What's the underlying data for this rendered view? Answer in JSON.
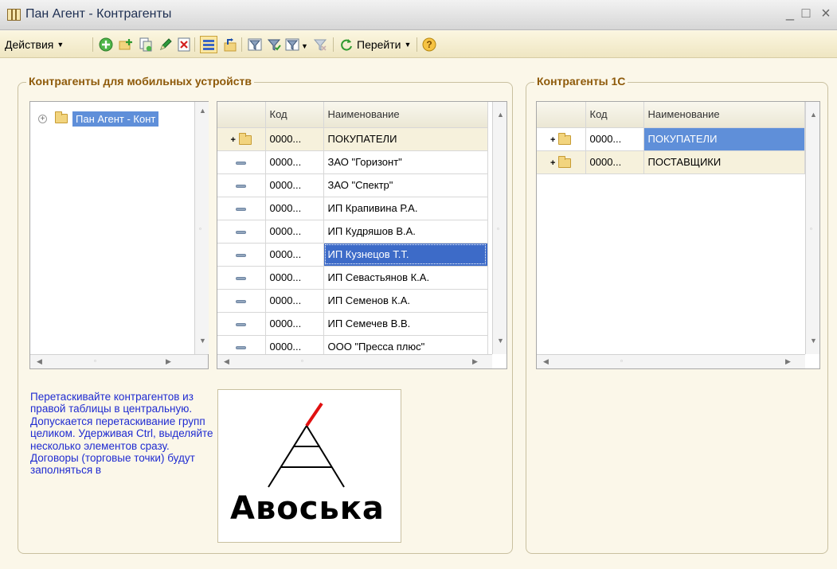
{
  "window": {
    "title": "Пан Агент - Контрагенты",
    "minimize": "_",
    "maximize": "□",
    "close": "×"
  },
  "toolbar": {
    "actions_label": "Действия",
    "goto_label": "Перейти",
    "icons": [
      "add-icon",
      "add-group-icon",
      "copy-icon",
      "edit-icon",
      "delete-icon",
      "list-view-icon",
      "refresh-level-icon",
      "filter-icon",
      "filter-value-icon",
      "filter-list-icon",
      "clear-filter-icon",
      "refresh-icon",
      "help-icon"
    ]
  },
  "left_group": {
    "title": "Контрагенты для мобильных устройств",
    "tree": {
      "label": "Пан Агент - Конт",
      "expander": "⊕"
    },
    "center_table": {
      "col_code": "Код",
      "col_name": "Наименование",
      "rows": [
        {
          "type": "group",
          "code": "0000...",
          "name": "ПОКУПАТЕЛИ",
          "marker": "+"
        },
        {
          "type": "item",
          "code": "0000...",
          "name": "ЗАО \"Горизонт\""
        },
        {
          "type": "item",
          "code": "0000...",
          "name": "ЗАО \"Спектр\""
        },
        {
          "type": "item",
          "code": "0000...",
          "name": "ИП Крапивина Р.А."
        },
        {
          "type": "item",
          "code": "0000...",
          "name": "ИП Кудряшов В.А."
        },
        {
          "type": "item",
          "code": "0000...",
          "name": "ИП Кузнецов Т.Т.",
          "selected": true
        },
        {
          "type": "item",
          "code": "0000...",
          "name": "ИП Севастьянов К.А."
        },
        {
          "type": "item",
          "code": "0000...",
          "name": "ИП Семенов К.А."
        },
        {
          "type": "item",
          "code": "0000...",
          "name": "ИП Семечев В.В."
        },
        {
          "type": "item",
          "code": "0000...",
          "name": "ООО \"Пресса плюс\""
        }
      ]
    },
    "hint": "Перетаскивайте контрагентов из правой таблицы в центральную. Допускается перетаскивание групп целиком. Удерживая Ctrl, выделяйте несколько элементов сразу. Договоры (торговые точки) будут заполняться в",
    "logo_text": "Авоська"
  },
  "right_group": {
    "title": "Контрагенты 1С",
    "table": {
      "col_code": "Код",
      "col_name": "Наименование",
      "rows": [
        {
          "type": "group",
          "code": "0000...",
          "name": "ПОКУПАТЕЛИ",
          "marker": "+",
          "selected": true
        },
        {
          "type": "group",
          "code": "0000...",
          "name": "ПОСТАВЩИКИ",
          "marker": "+"
        }
      ]
    }
  },
  "colors": {
    "accent_title": "#8e5a0a",
    "selection": "#3d6bc8",
    "hint_text": "#1f2bd1",
    "logo_line": "#e01010"
  }
}
